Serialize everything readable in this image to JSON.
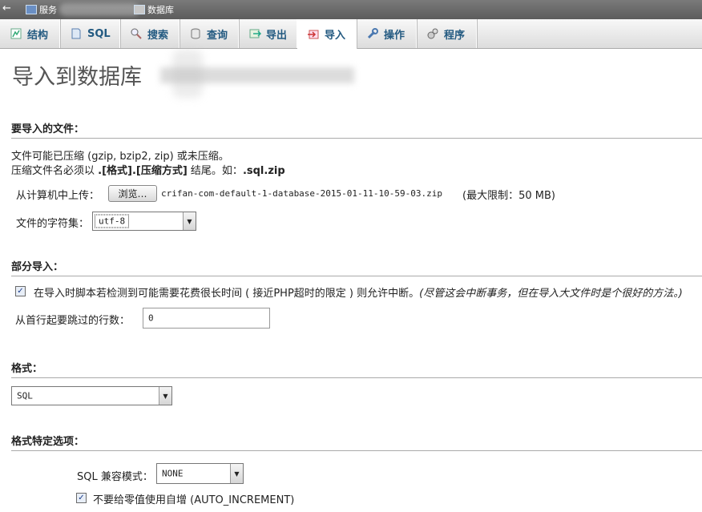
{
  "breadcrumb": {
    "back_icon": "back-arrow-icon",
    "server_label": "服务",
    "db_label": "数据库"
  },
  "tabs": [
    {
      "label": "结构",
      "icon": "structure-icon"
    },
    {
      "label": "SQL",
      "icon": "sql-icon"
    },
    {
      "label": "搜索",
      "icon": "search-icon"
    },
    {
      "label": "查询",
      "icon": "query-icon"
    },
    {
      "label": "导出",
      "icon": "export-icon"
    },
    {
      "label": "导入",
      "icon": "import-icon",
      "active": true
    },
    {
      "label": "操作",
      "icon": "wrench-icon"
    },
    {
      "label": "程序",
      "icon": "routines-icon"
    }
  ],
  "page_title": "导入到数据库",
  "file_section": {
    "heading": "要导入的文件：",
    "line1": "文件可能已压缩 (gzip, bzip2, zip) 或未压缩。",
    "line2_prefix": "压缩文件名必须以 ",
    "line2_format": ".[格式].[压缩方式]",
    "line2_mid": " 结尾。如：",
    "line2_example": ".sql.zip",
    "upload_label": "从计算机中上传：",
    "browse_button": "浏览…",
    "file_name": "crifan-com-default-1-database-2015-01-11-10-59-03.zip",
    "max_limit": "(最大限制：50 MB)",
    "charset_label": "文件的字符集：",
    "charset_value": "utf-8"
  },
  "partial_section": {
    "heading": "部分导入：",
    "allow_interrupt_checked": true,
    "allow_interrupt_text": "在导入时脚本若检测到可能需要花费很长时间 ( 接近PHP超时的限定 ) 则允许中断。",
    "allow_interrupt_note": "(尽管这会中断事务，但在导入大文件时是个很好的方法。)",
    "skip_label": "从首行起要跳过的行数：",
    "skip_value": "0"
  },
  "format_section": {
    "heading": "格式：",
    "format_value": "SQL"
  },
  "format_options_section": {
    "heading": "格式特定选项：",
    "compat_label": "SQL 兼容模式：",
    "compat_value": "NONE",
    "no_auto_value_checked": true,
    "no_auto_value_text": "不要给零值使用自增 (AUTO_INCREMENT)"
  }
}
